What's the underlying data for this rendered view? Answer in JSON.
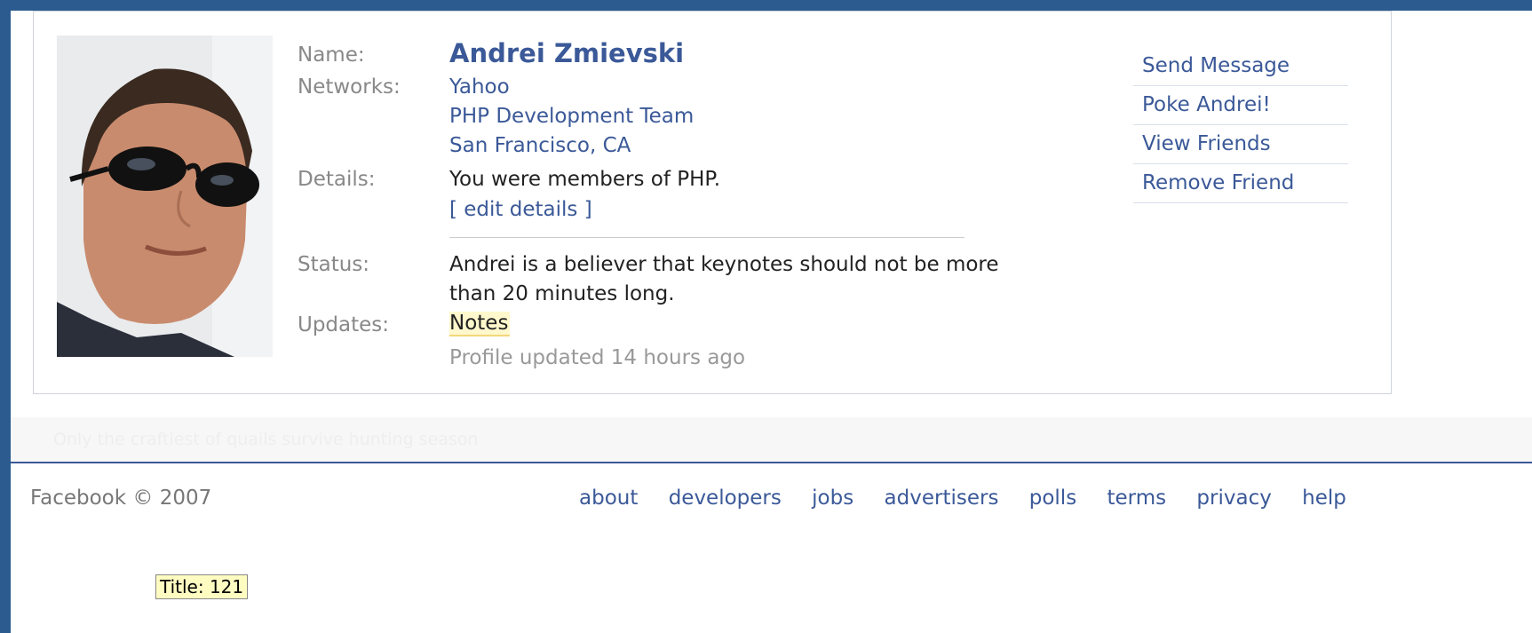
{
  "profile": {
    "name": "Andrei Zmievski",
    "labels": {
      "name": "Name:",
      "networks": "Networks:",
      "details": "Details:",
      "status": "Status:",
      "updates": "Updates:"
    },
    "networks": [
      "Yahoo",
      "PHP Development Team",
      "San Francisco, CA"
    ],
    "details": "You were members of PHP.",
    "edit_details": "[ edit details ]",
    "status_line1": "Andrei is a believer that keynotes should not be more",
    "status_line2": "than 20 minutes long.",
    "updates_link": "Notes",
    "profile_updated": "Profile updated 14 hours ago"
  },
  "actions": [
    "Send Message",
    "Poke Andrei!",
    "View Friends",
    "Remove Friend"
  ],
  "faint_text": "Only the craftiest of quails survive hunting season",
  "footer": {
    "copyright": "Facebook © 2007",
    "links": [
      "about",
      "developers",
      "jobs",
      "advertisers",
      "polls",
      "terms",
      "privacy",
      "help"
    ]
  },
  "tooltip": "Title: 121",
  "colors": {
    "frame": "#2c5b8f",
    "link": "#3b5998",
    "label": "#888888",
    "highlight": "#fff8cc"
  }
}
